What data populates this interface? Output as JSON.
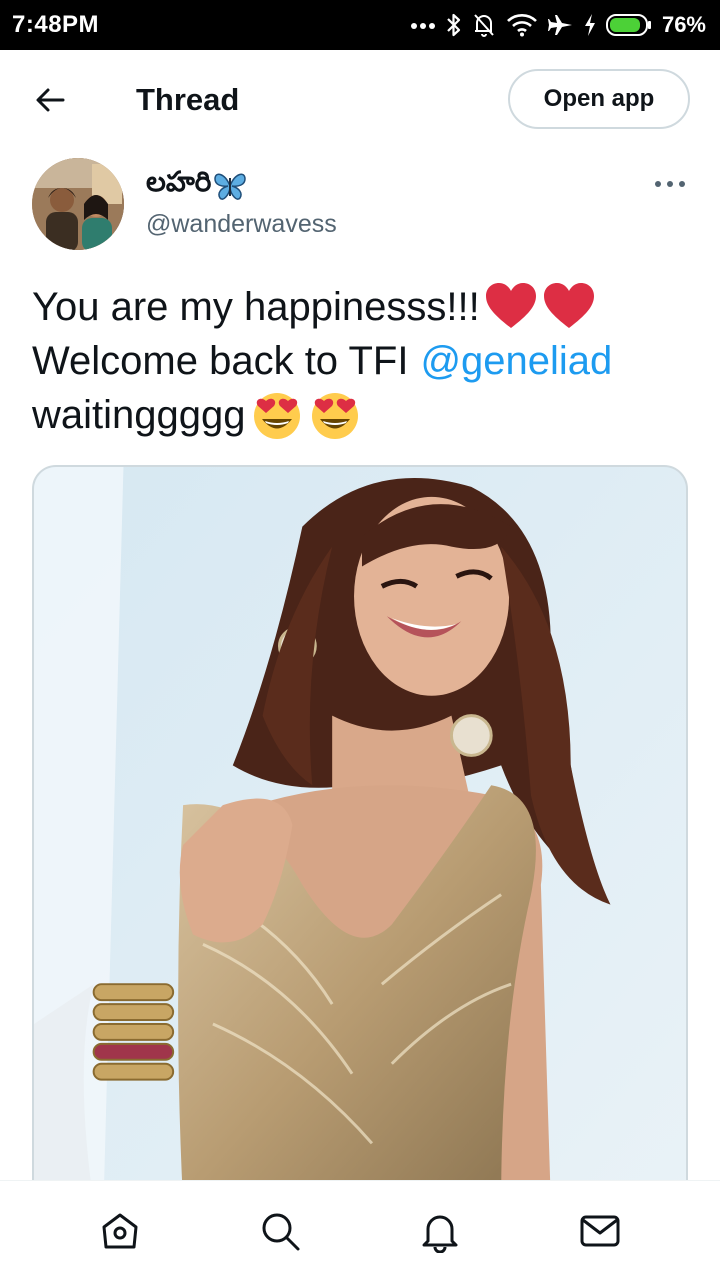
{
  "status_bar": {
    "time": "7:48PM",
    "battery_percent": "76%",
    "icons": [
      "dots-icon",
      "bluetooth-icon",
      "bell-off-icon",
      "wifi-icon",
      "airplane-icon",
      "charging-icon",
      "battery-icon"
    ]
  },
  "header": {
    "back_icon": "arrow-left-icon",
    "title": "Thread",
    "open_app_label": "Open app"
  },
  "tweet": {
    "author": {
      "display_name": "లహరి",
      "display_name_emoji": "butterfly",
      "handle": "@wanderwavess"
    },
    "more_icon": "more-dots-icon",
    "text_lines": {
      "line1": "You are my happinesss!!!",
      "line2_text": "Welcome back to TFI",
      "line2_mention": "@geneliad",
      "line3": "waitinggggg"
    },
    "emojis": [
      "red-heart",
      "red-heart",
      "smiling-face-with-heart-eyes",
      "smiling-face-with-heart-eyes"
    ],
    "media": {
      "type": "photo"
    }
  },
  "bottom_nav": {
    "items": [
      "home-icon",
      "search-icon",
      "notifications-icon",
      "messages-icon"
    ]
  },
  "colors": {
    "text": "#0f1419",
    "secondary": "#536471",
    "link": "#1d9bf0",
    "border": "#cfd9de",
    "heart": "#dd2e44",
    "battery": "#4cd137"
  }
}
